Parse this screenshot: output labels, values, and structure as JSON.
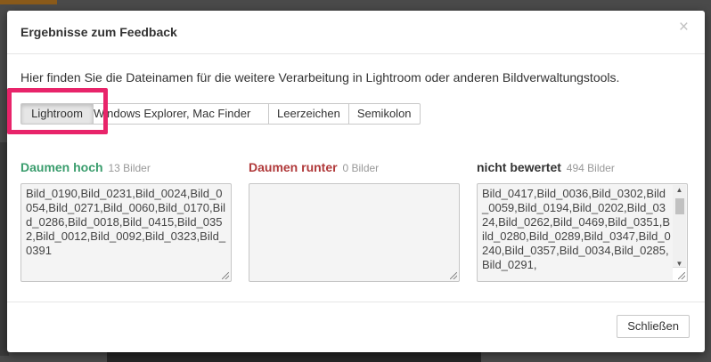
{
  "dialog": {
    "title": "Ergebnisse zum Feedback",
    "close_symbol": "×",
    "intro": "Hier finden Sie die Dateinamen für die weitere Verarbeitung in Lightroom oder anderen Bildverwaltungstools.",
    "format_buttons": [
      {
        "label": "Lightroom",
        "active": true
      },
      {
        "label": "Windows Explorer, Mac Finder",
        "active": false
      },
      {
        "label": "Leerzeichen",
        "active": false
      },
      {
        "label": "Semikolon",
        "active": false
      }
    ],
    "highlight_color": "#e8246a",
    "footer_close": "Schließen"
  },
  "columns": [
    {
      "title": "Daumen hoch",
      "count": "13 Bilder",
      "color": "#3a9d6d",
      "content": "Bild_0190,Bild_0231,Bild_0024,Bild_0054,Bild_0271,Bild_0060,Bild_0170,Bild_0286,Bild_0018,Bild_0415,Bild_0352,Bild_0012,Bild_0092,Bild_0323,Bild_0391"
    },
    {
      "title": "Daumen runter",
      "count": "0 Bilder",
      "color": "#b0393a",
      "content": ""
    },
    {
      "title": "nicht bewertet",
      "count": "494 Bilder",
      "color": "#333333",
      "content": "Bild_0417,Bild_0036,Bild_0302,Bild_0059,Bild_0194,Bild_0202,Bild_0324,Bild_0262,Bild_0469,Bild_0351,Bild_0280,Bild_0289,Bild_0347,Bild_0240,Bild_0357,Bild_0034,Bild_0285,Bild_0291,"
    }
  ],
  "scroll_arrows": {
    "up": "▲",
    "down": "▼"
  }
}
